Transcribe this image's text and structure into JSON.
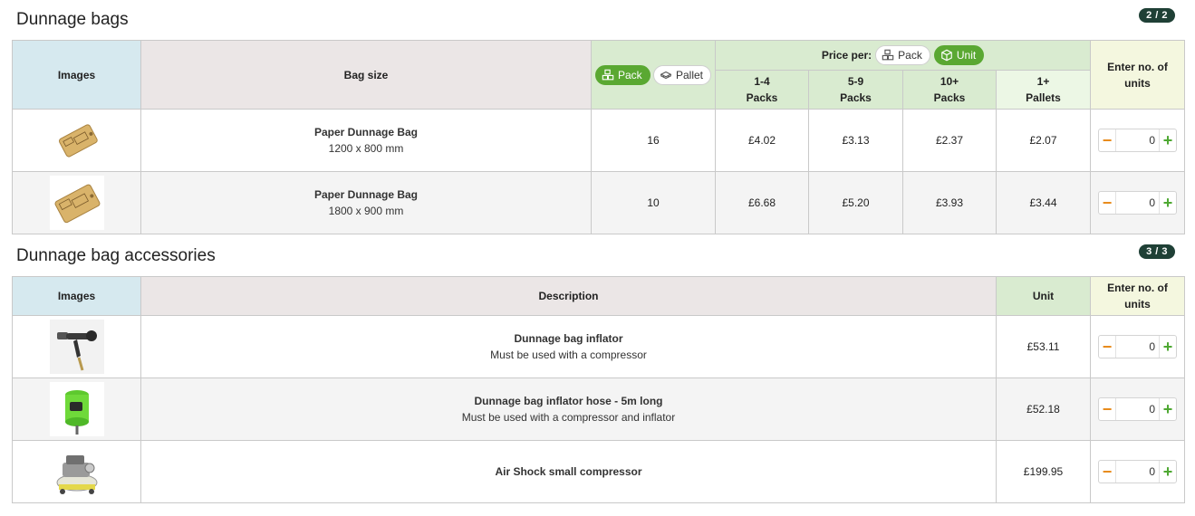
{
  "section1": {
    "title": "Dunnage bags",
    "counter": "2 / 2",
    "headers": {
      "images": "Images",
      "bag_size": "Bag size",
      "toggle_pack": "Pack",
      "toggle_pallet": "Pallet",
      "price_per": "Price per:",
      "price_pack": "Pack",
      "price_unit": "Unit",
      "tiers": [
        {
          "line1": "1-4",
          "line2": "Packs"
        },
        {
          "line1": "5-9",
          "line2": "Packs"
        },
        {
          "line1": "10+",
          "line2": "Packs"
        },
        {
          "line1": "1+",
          "line2": "Pallets"
        }
      ],
      "enter": "Enter no. of units"
    },
    "rows": [
      {
        "name": "Paper Dunnage Bag",
        "size": "1200 x 800 mm",
        "qty": "16",
        "prices": [
          "£4.02",
          "£3.13",
          "£2.37",
          "£2.07"
        ],
        "units": "0"
      },
      {
        "name": "Paper Dunnage Bag",
        "size": "1800 x 900 mm",
        "qty": "10",
        "prices": [
          "£6.68",
          "£5.20",
          "£3.93",
          "£3.44"
        ],
        "units": "0"
      }
    ]
  },
  "section2": {
    "title": "Dunnage bag accessories",
    "counter": "3 / 3",
    "headers": {
      "images": "Images",
      "description": "Description",
      "unit": "Unit",
      "enter": "Enter no. of units"
    },
    "rows": [
      {
        "name": "Dunnage bag inflator",
        "sub": "Must be used with a compressor",
        "price": "£53.11",
        "units": "0"
      },
      {
        "name": "Dunnage bag inflator hose - 5m long",
        "sub": "Must be used with a compressor and inflator",
        "price": "£52.18",
        "units": "0"
      },
      {
        "name": "Air Shock small compressor",
        "sub": "",
        "price": "£199.95",
        "units": "0"
      }
    ]
  },
  "stepper": {
    "minus": "−",
    "plus": "+"
  },
  "icons": {
    "toggle_pack": "boxes-icon",
    "toggle_pallet": "pallet-icon",
    "price_pack": "boxes-icon",
    "price_unit": "box-icon"
  },
  "colors": {
    "accent_green": "#5aa832",
    "minus_orange": "#e88a1a",
    "counter_bg": "#1f4036"
  }
}
